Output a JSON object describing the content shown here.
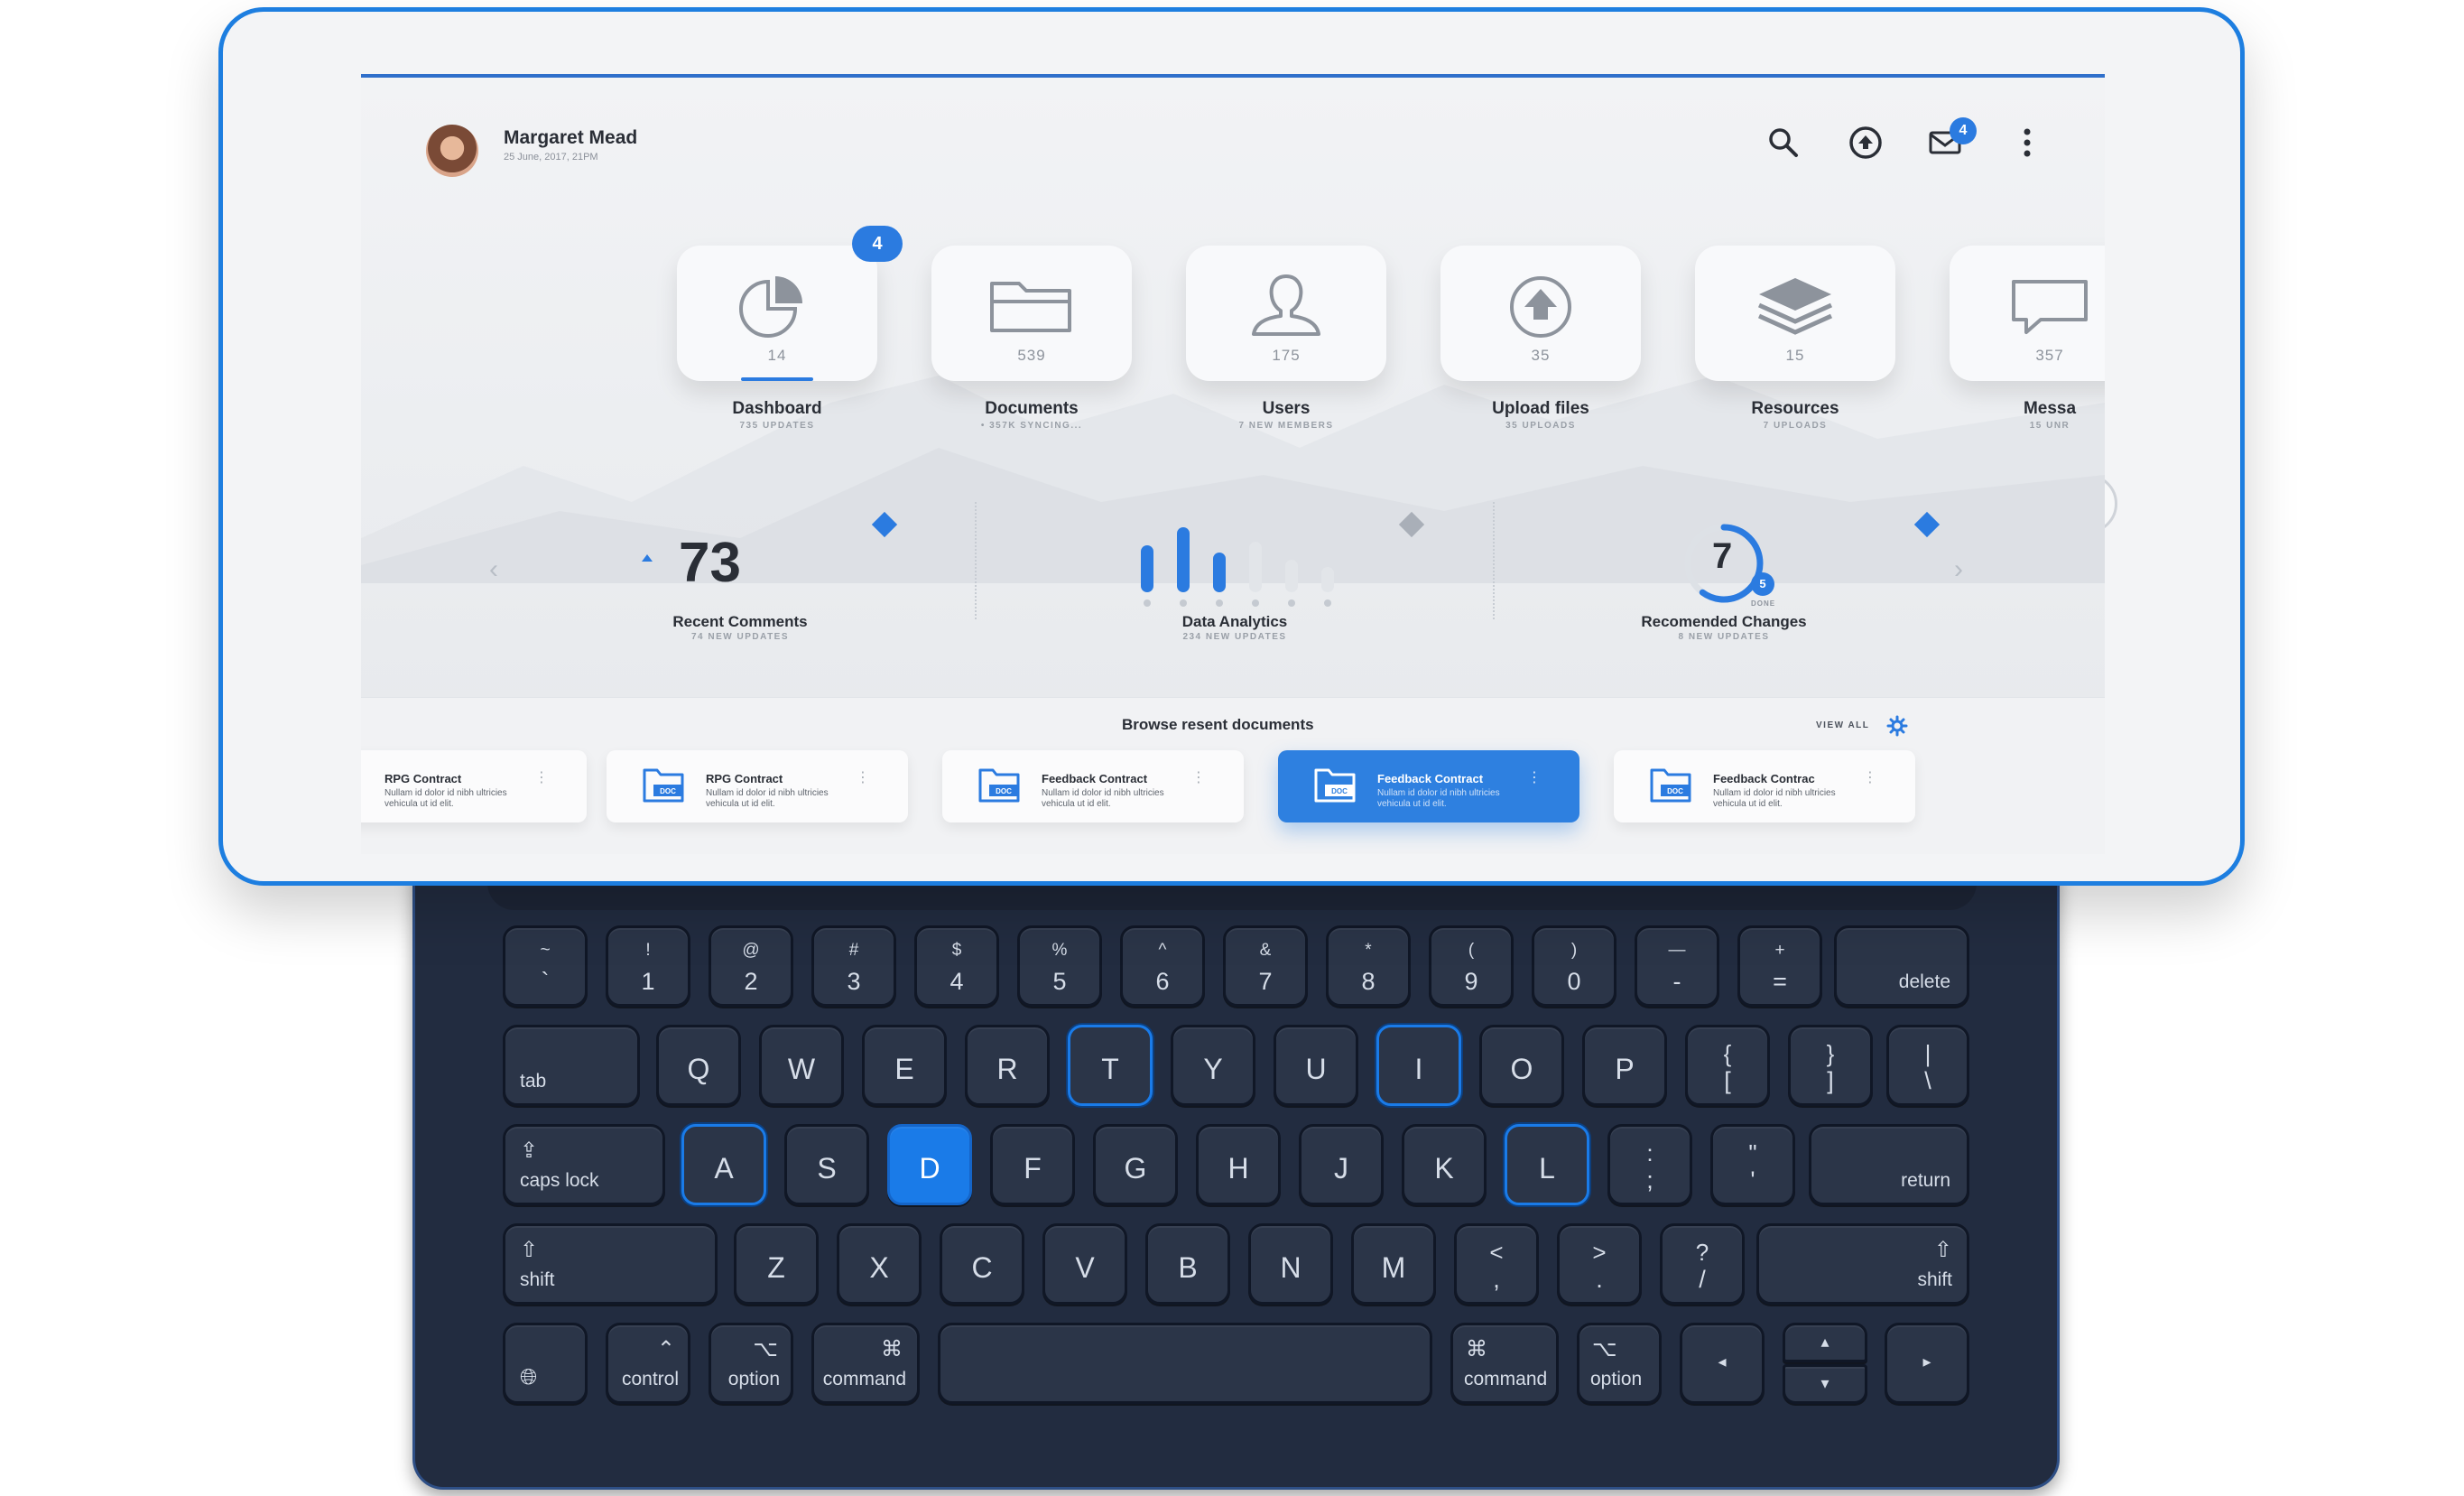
{
  "user": {
    "name": "Margaret Mead",
    "date": "25 June, 2017, 21PM"
  },
  "header": {
    "icons": [
      "search-icon",
      "upload-icon",
      "mail-icon",
      "more-vertical-icon"
    ],
    "mail_badge": "4"
  },
  "modules": [
    {
      "label": "Dashboard",
      "count": "14",
      "sub": "735 UPDATES",
      "icon": "pie-chart-icon",
      "badge": "4",
      "active": true
    },
    {
      "label": "Documents",
      "count": "539",
      "sub": "• 357K SYNCING...",
      "icon": "folder-icon"
    },
    {
      "label": "Users",
      "count": "175",
      "sub": "7 NEW MEMBERS",
      "icon": "user-icon"
    },
    {
      "label": "Upload files",
      "count": "35",
      "sub": "35 UPLOADS",
      "icon": "upload-icon"
    },
    {
      "label": "Resources",
      "count": "15",
      "sub": "7 UPLOADS",
      "icon": "layers-icon"
    },
    {
      "label": "Messa",
      "count": "357",
      "sub": "15 UNR",
      "icon": "message-icon"
    }
  ],
  "stats": {
    "comments": {
      "value": "73",
      "title": "Recent Comments",
      "sub": "74 NEW UPDATES"
    },
    "analytics": {
      "title": "Data Analytics",
      "sub": "234 NEW UPDATES",
      "bars": [
        0.65,
        0.9,
        0.55,
        0.7,
        0.45,
        0.35
      ]
    },
    "changes": {
      "value": "7",
      "badge": "5",
      "done": "DONE",
      "title": "Recomended Changes",
      "sub": "8 NEW UPDATES",
      "progress": 0.6
    }
  },
  "documents": {
    "title": "Browse resent documents",
    "view_all": "VIEW ALL",
    "items": [
      {
        "title": "RPG Contract",
        "desc": "Nullam id dolor id nibh ultricies vehicula ut id elit."
      },
      {
        "title": "RPG Contract",
        "desc": "Nullam id dolor id nibh ultricies vehicula ut id elit."
      },
      {
        "title": "Feedback Contract",
        "desc": "Nullam id dolor id nibh ultricies vehicula ut id elit."
      },
      {
        "title": "Feedback Contract",
        "desc": "Nullam id dolor id nibh ultricies vehicula ut id elit.",
        "active": true
      },
      {
        "title": "Feedback Contrac",
        "desc": "Nullam id dolor id nibh ultricies vehicula ut id elit."
      }
    ],
    "doc_tag": "DOC"
  },
  "keyboard": {
    "row1": [
      [
        "~",
        "`"
      ],
      [
        "!",
        "1"
      ],
      [
        "@",
        "2"
      ],
      [
        "#",
        "3"
      ],
      [
        "$",
        "4"
      ],
      [
        "%",
        "5"
      ],
      [
        "^",
        "6"
      ],
      [
        "&",
        "7"
      ],
      [
        "*",
        "8"
      ],
      [
        "(",
        "9"
      ],
      [
        ")",
        "0"
      ],
      [
        "—",
        "-"
      ],
      [
        "+",
        "="
      ]
    ],
    "delete": "delete",
    "tab": "tab",
    "row2": [
      "Q",
      "W",
      "E",
      "R",
      "T",
      "Y",
      "U",
      "I",
      "O",
      "P"
    ],
    "row2_sym": [
      [
        "{",
        "["
      ],
      [
        "}",
        "]"
      ],
      [
        "|",
        "\\"
      ]
    ],
    "caps": "caps lock",
    "row3": [
      "A",
      "S",
      "D",
      "F",
      "G",
      "H",
      "J",
      "K",
      "L"
    ],
    "row3_sym": [
      [
        ":",
        ";"
      ],
      [
        "\"",
        "'"
      ]
    ],
    "return": "return",
    "shift": "shift",
    "row4": [
      "Z",
      "X",
      "C",
      "V",
      "B",
      "N",
      "M"
    ],
    "row4_sym": [
      [
        "<",
        ","
      ],
      [
        ">",
        "."
      ],
      [
        "?",
        "/"
      ]
    ],
    "control": "control",
    "option": "option",
    "command": "command",
    "highlighted": [
      "T",
      "I",
      "A",
      "L"
    ],
    "active": "D"
  }
}
